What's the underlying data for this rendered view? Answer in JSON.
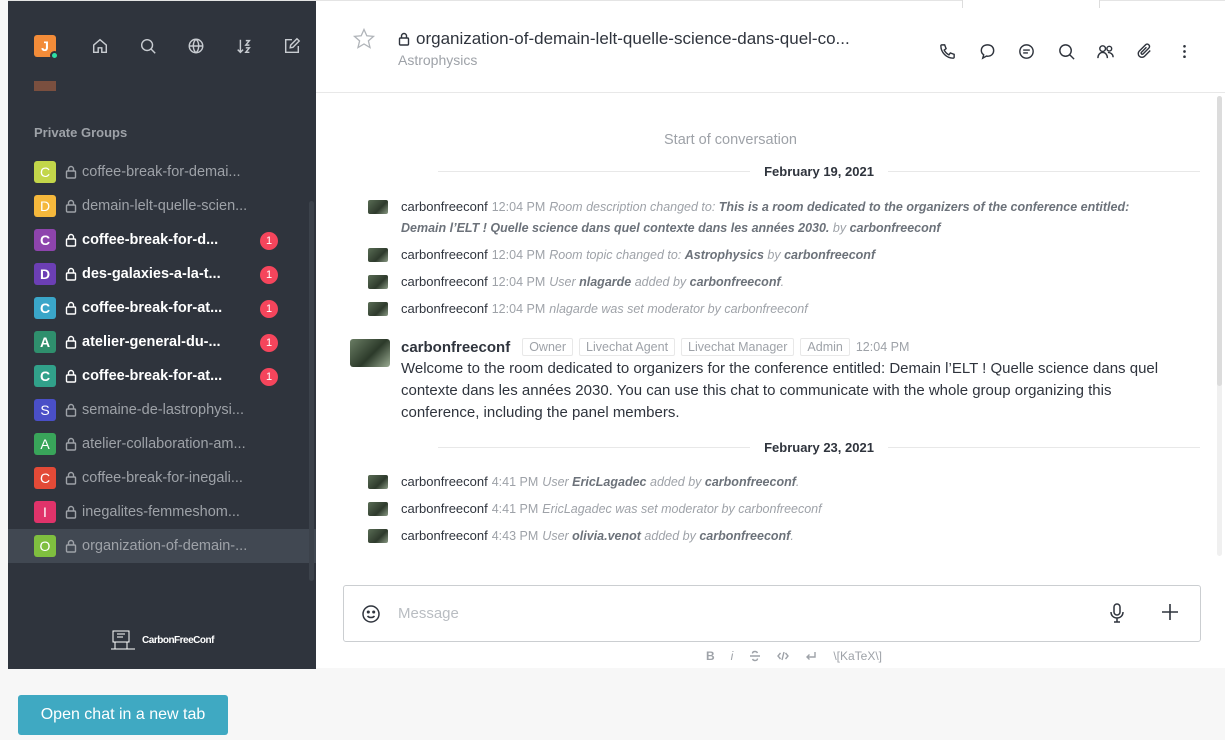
{
  "header_user": {
    "initial": "J"
  },
  "section_title": "Private Groups",
  "rooms": [
    {
      "initial": "C",
      "color": "#c3d64a",
      "name": "coffee-break-for-demai...",
      "unread": false,
      "badge": ""
    },
    {
      "initial": "D",
      "color": "#f5b83c",
      "name": "demain-lelt-quelle-scien...",
      "unread": false,
      "badge": ""
    },
    {
      "initial": "C",
      "color": "#8e44ad",
      "name": "coffee-break-for-d...",
      "unread": true,
      "badge": "1"
    },
    {
      "initial": "D",
      "color": "#6c3fb5",
      "name": "des-galaxies-a-la-t...",
      "unread": true,
      "badge": "1"
    },
    {
      "initial": "C",
      "color": "#3aa6c9",
      "name": "coffee-break-for-at...",
      "unread": true,
      "badge": "1"
    },
    {
      "initial": "A",
      "color": "#2f8f6d",
      "name": "atelier-general-du-...",
      "unread": true,
      "badge": "1"
    },
    {
      "initial": "C",
      "color": "#31a18a",
      "name": "coffee-break-for-at...",
      "unread": true,
      "badge": "1"
    },
    {
      "initial": "S",
      "color": "#4a4fc7",
      "name": "semaine-de-lastrophysi...",
      "unread": false,
      "badge": ""
    },
    {
      "initial": "A",
      "color": "#39a55a",
      "name": "atelier-collaboration-am...",
      "unread": false,
      "badge": ""
    },
    {
      "initial": "C",
      "color": "#e34a37",
      "name": "coffee-break-for-inegali...",
      "unread": false,
      "badge": ""
    },
    {
      "initial": "I",
      "color": "#e0336a",
      "name": "inegalites-femmeshom...",
      "unread": false,
      "badge": ""
    },
    {
      "initial": "O",
      "color": "#7fbf3f",
      "name": "organization-of-demain-...",
      "unread": false,
      "badge": "",
      "active": true
    }
  ],
  "logo_text": "CarbonFreeConf",
  "room_header": {
    "title": "organization-of-demain-lelt-quelle-science-dans-quel-co...",
    "topic": "Astrophysics"
  },
  "messages": {
    "start": "Start of conversation",
    "day1": "February 19, 2021",
    "day2": "February 23, 2021",
    "sys1": [
      {
        "user": "carbonfreeconf",
        "time": "12:04 PM",
        "pre": "Room description changed to: ",
        "bold": "This is a room dedicated to the organizers of the conference entitled: Demain l’ELT ! Quelle science dans quel contexte dans les années 2030.",
        "post": " by ",
        "bold2": "carbonfreeconf"
      },
      {
        "user": "carbonfreeconf",
        "time": "12:04 PM",
        "pre": "Room topic changed to: ",
        "bold": "Astrophysics",
        "post": " by ",
        "bold2": "carbonfreeconf"
      },
      {
        "user": "carbonfreeconf",
        "time": "12:04 PM",
        "pre": "User ",
        "bold": "nlagarde",
        "post": " added by ",
        "bold2": "carbonfreeconf",
        "tail": "."
      },
      {
        "user": "carbonfreeconf",
        "time": "12:04 PM",
        "pre": "nlagarde was set moderator by carbonfreeconf",
        "bold": "",
        "post": "",
        "bold2": ""
      }
    ],
    "full": {
      "user": "carbonfreeconf",
      "roles": [
        "Owner",
        "Livechat Agent",
        "Livechat Manager",
        "Admin"
      ],
      "time": "12:04 PM",
      "text": "Welcome to the room dedicated to organizers for the conference entitled: Demain l’ELT ! Quelle science dans quel contexte dans les années 2030. You can use this chat to communicate with the whole group organizing this conference, including the panel members."
    },
    "sys2": [
      {
        "user": "carbonfreeconf",
        "time": "4:41 PM",
        "pre": "User ",
        "bold": "EricLagadec",
        "post": " added by ",
        "bold2": "carbonfreeconf",
        "tail": "."
      },
      {
        "user": "carbonfreeconf",
        "time": "4:41 PM",
        "pre": "EricLagadec was set moderator by carbonfreeconf",
        "bold": "",
        "post": "",
        "bold2": ""
      },
      {
        "user": "carbonfreeconf",
        "time": "4:43 PM",
        "pre": "User ",
        "bold": "olivia.venot",
        "post": " added by ",
        "bold2": "carbonfreeconf",
        "tail": "."
      }
    ]
  },
  "composer": {
    "placeholder": "Message"
  },
  "format_bar": {
    "bold": "B",
    "italic": "i",
    "katex": "\\[KaTeX\\]"
  },
  "open_tab_label": "Open chat in a new tab"
}
